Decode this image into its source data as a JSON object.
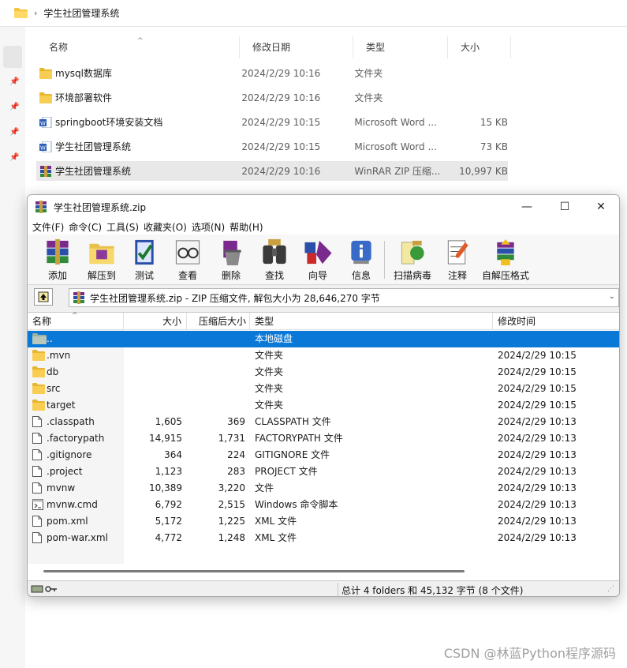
{
  "explorer": {
    "breadcrumb": "学生社团管理系统",
    "columns": {
      "name": "名称",
      "date": "修改日期",
      "type": "类型",
      "size": "大小"
    },
    "rows": [
      {
        "name": "mysql数据库",
        "date": "2024/2/29 10:16",
        "type": "文件夹",
        "size": "",
        "icon": "folder-icon"
      },
      {
        "name": "环境部署软件",
        "date": "2024/2/29 10:16",
        "type": "文件夹",
        "size": "",
        "icon": "folder-icon"
      },
      {
        "name": "springboot环境安装文档",
        "date": "2024/2/29 10:15",
        "type": "Microsoft Word ...",
        "size": "15 KB",
        "icon": "word-doc-icon"
      },
      {
        "name": "学生社团管理系统",
        "date": "2024/2/29 10:15",
        "type": "Microsoft Word ...",
        "size": "73 KB",
        "icon": "word-doc-icon"
      },
      {
        "name": "学生社团管理系统",
        "date": "2024/2/29 10:16",
        "type": "WinRAR ZIP 压缩...",
        "size": "10,997 KB",
        "icon": "winrar-archive-icon",
        "selected": true
      }
    ]
  },
  "winrar": {
    "title": "学生社团管理系统.zip",
    "window_controls": {
      "minimize": "—",
      "maximize": "☐",
      "close": "✕"
    },
    "menu": [
      "文件(F)",
      "命令(C)",
      "工具(S)",
      "收藏夹(O)",
      "选项(N)",
      "帮助(H)"
    ],
    "toolbar": [
      "添加",
      "解压到",
      "测试",
      "查看",
      "删除",
      "查找",
      "向导",
      "信息",
      "扫描病毒",
      "注释",
      "自解压格式"
    ],
    "path": "学生社团管理系统.zip - ZIP 压缩文件, 解包大小为 28,646,270 字节",
    "columns": {
      "name": "名称",
      "size": "大小",
      "packed": "压缩后大小",
      "type": "类型",
      "modified": "修改时间"
    },
    "rows": [
      {
        "name": "..",
        "size": "",
        "packed": "",
        "type": "本地磁盘",
        "modified": "",
        "icon": "parent-folder-icon",
        "selected": true
      },
      {
        "name": ".mvn",
        "size": "",
        "packed": "",
        "type": "文件夹",
        "modified": "2024/2/29 10:15",
        "icon": "folder-icon"
      },
      {
        "name": "db",
        "size": "",
        "packed": "",
        "type": "文件夹",
        "modified": "2024/2/29 10:15",
        "icon": "folder-icon"
      },
      {
        "name": "src",
        "size": "",
        "packed": "",
        "type": "文件夹",
        "modified": "2024/2/29 10:15",
        "icon": "folder-icon"
      },
      {
        "name": "target",
        "size": "",
        "packed": "",
        "type": "文件夹",
        "modified": "2024/2/29 10:15",
        "icon": "folder-icon"
      },
      {
        "name": ".classpath",
        "size": "1,605",
        "packed": "369",
        "type": "CLASSPATH 文件",
        "modified": "2024/2/29 10:13",
        "icon": "file-icon"
      },
      {
        "name": ".factorypath",
        "size": "14,915",
        "packed": "1,731",
        "type": "FACTORYPATH 文件",
        "modified": "2024/2/29 10:13",
        "icon": "file-icon"
      },
      {
        "name": ".gitignore",
        "size": "364",
        "packed": "224",
        "type": "GITIGNORE 文件",
        "modified": "2024/2/29 10:13",
        "icon": "file-icon"
      },
      {
        "name": ".project",
        "size": "1,123",
        "packed": "283",
        "type": "PROJECT 文件",
        "modified": "2024/2/29 10:13",
        "icon": "file-icon"
      },
      {
        "name": "mvnw",
        "size": "10,389",
        "packed": "3,220",
        "type": "文件",
        "modified": "2024/2/29 10:13",
        "icon": "file-icon"
      },
      {
        "name": "mvnw.cmd",
        "size": "6,792",
        "packed": "2,515",
        "type": "Windows 命令脚本",
        "modified": "2024/2/29 10:13",
        "icon": "script-file-icon"
      },
      {
        "name": "pom.xml",
        "size": "5,172",
        "packed": "1,225",
        "type": "XML 文件",
        "modified": "2024/2/29 10:13",
        "icon": "file-icon"
      },
      {
        "name": "pom-war.xml",
        "size": "4,772",
        "packed": "1,248",
        "type": "XML 文件",
        "modified": "2024/2/29 10:13",
        "icon": "file-icon"
      }
    ],
    "status": "总计 4 folders 和 45,132 字节 (8 个文件)"
  },
  "watermark": "CSDN @林蓝Python程序源码",
  "colors": {
    "selection_blue": "#0a78d7",
    "folder_yellow": "#f5c342"
  }
}
